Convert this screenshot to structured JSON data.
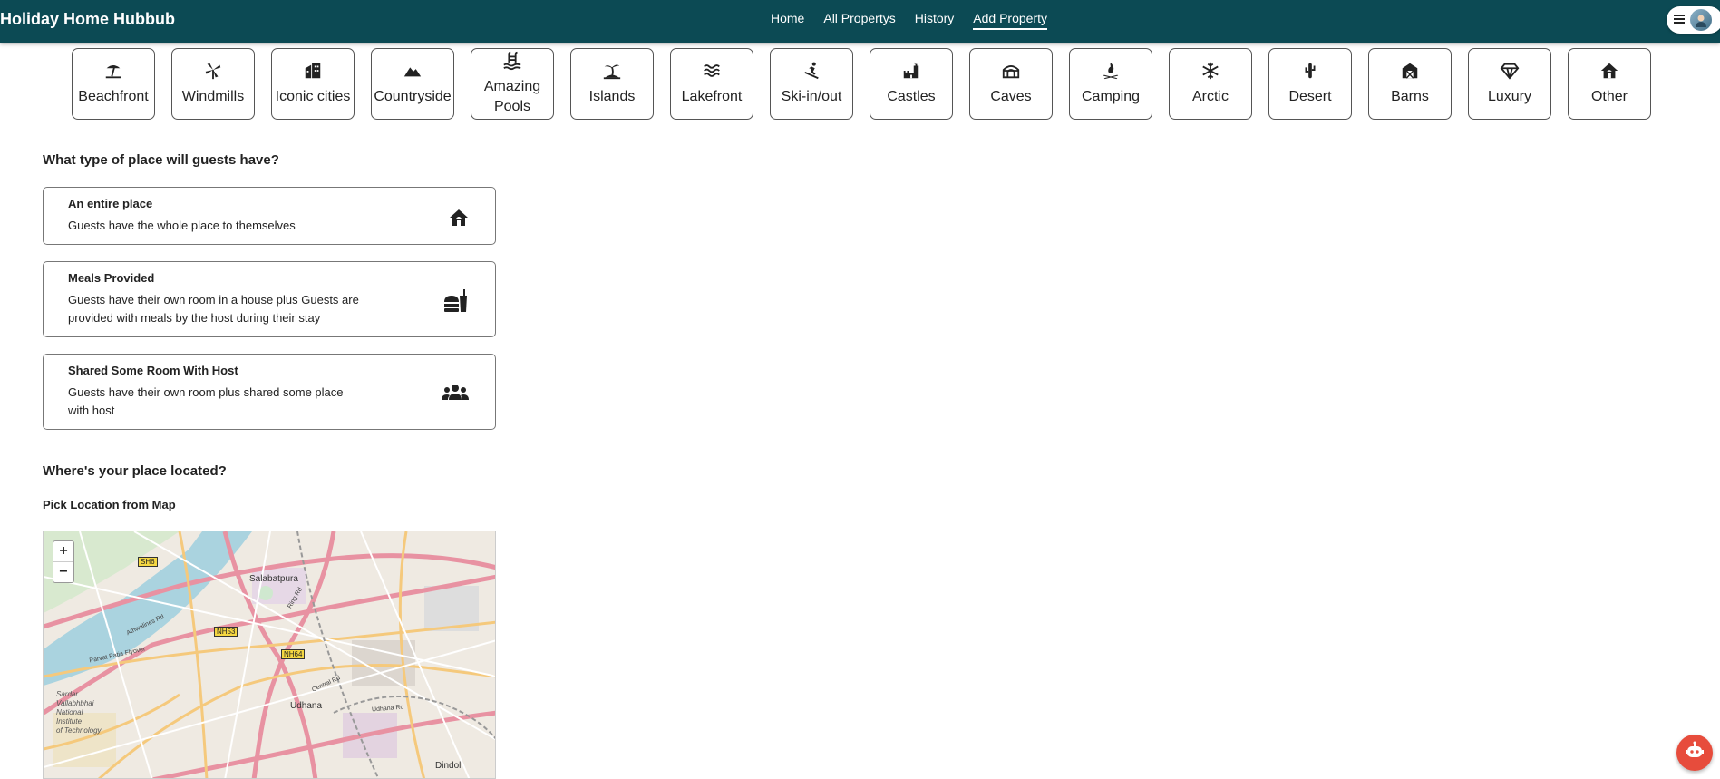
{
  "header": {
    "brand": "Holiday Home Hubbub",
    "nav": [
      {
        "label": "Home"
      },
      {
        "label": "All Propertys"
      },
      {
        "label": "History"
      },
      {
        "label": "Add Property"
      }
    ],
    "active_nav": "Add Property",
    "menu_icon": "hamburger-icon",
    "avatar_icon": "user-avatar"
  },
  "categories": [
    {
      "label": "Beachfront",
      "icon": "beach-umbrella-icon"
    },
    {
      "label": "Windmills",
      "icon": "windmill-icon"
    },
    {
      "label": "Iconic cities",
      "icon": "city-building-icon"
    },
    {
      "label": "Countryside",
      "icon": "mountain-icon"
    },
    {
      "label": "Amazing Pools",
      "icon": "swimming-pool-icon"
    },
    {
      "label": "Islands",
      "icon": "island-palm-icon"
    },
    {
      "label": "Lakefront",
      "icon": "water-waves-icon"
    },
    {
      "label": "Ski-in/out",
      "icon": "skier-icon"
    },
    {
      "label": "Castles",
      "icon": "castle-icon"
    },
    {
      "label": "Caves",
      "icon": "cave-icon"
    },
    {
      "label": "Camping",
      "icon": "campfire-icon"
    },
    {
      "label": "Arctic",
      "icon": "snowflake-icon"
    },
    {
      "label": "Desert",
      "icon": "cactus-icon"
    },
    {
      "label": "Barns",
      "icon": "barn-icon"
    },
    {
      "label": "Luxury",
      "icon": "diamond-icon"
    },
    {
      "label": "Other",
      "icon": "house-icon"
    }
  ],
  "place_type": {
    "question": "What type of place will guests have?",
    "options": [
      {
        "title": "An entire place",
        "description": "Guests have the whole place to themselves",
        "icon": "house-icon"
      },
      {
        "title": "Meals Provided",
        "description": "Guests have their own room in a house plus Guests are provided with meals by the host during their stay",
        "icon": "meal-burger-drink-icon"
      },
      {
        "title": "Shared Some Room With Host",
        "description": "Guests have their own room plus shared some place with host",
        "icon": "people-group-icon"
      }
    ]
  },
  "location": {
    "question": "Where's your place located?",
    "pick_label": "Pick Location from Map",
    "map": {
      "zoom_in": "+",
      "zoom_out": "−",
      "labels": {
        "salabatpura": "Salabatpura",
        "udhana": "Udhana",
        "dindoli": "Dindoli",
        "svnit_1": "Sardar",
        "svnit_2": "Vallabhbhai",
        "svnit_3": "National",
        "svnit_4": "Institute",
        "svnit_5": "of Technology",
        "sh6": "SH6",
        "nh53": "NH53",
        "nh64": "NH64",
        "flyover": "Parvat Patia Flyover",
        "ring_rd": "Ring Rd",
        "central_rd": "Central Rd",
        "udhana_rd": "Udhana Rd",
        "athwalines": "Athwalines Rd"
      }
    }
  },
  "chatbot": {
    "icon": "chatbot-icon"
  },
  "colors": {
    "header_bg": "#0c4a54",
    "chatbot_bg": "#e74c3c"
  }
}
